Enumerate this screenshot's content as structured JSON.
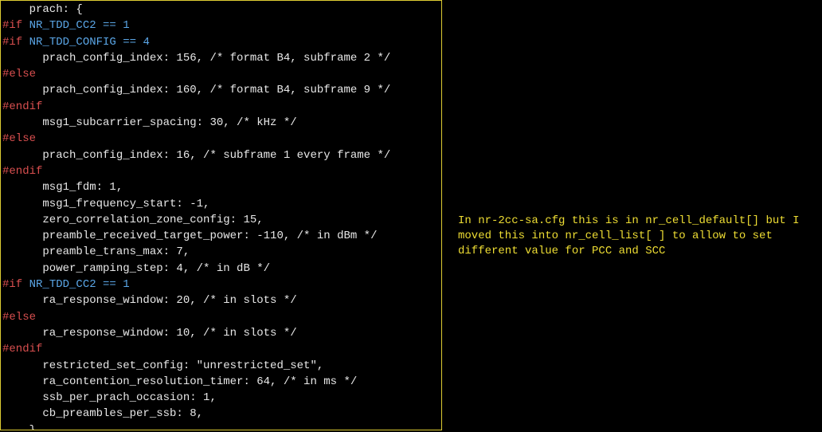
{
  "code": {
    "l0": "    prach: {",
    "l1a": "#if",
    "l1b": " NR_TDD_CC2 == 1",
    "l2a": "#if",
    "l2b": " NR_TDD_CONFIG == 4",
    "l3": "      prach_config_index: 156, /* format B4, subframe 2 */",
    "l4": "#else",
    "l5": "      prach_config_index: 160, /* format B4, subframe 9 */",
    "l6": "#endif",
    "l7": "      msg1_subcarrier_spacing: 30, /* kHz */",
    "l8": "#else",
    "l9": "      prach_config_index: 16, /* subframe 1 every frame */",
    "l10": "#endif",
    "l11": "      msg1_fdm: 1,",
    "l12": "      msg1_frequency_start: -1,",
    "l13": "      zero_correlation_zone_config: 15,",
    "l14": "      preamble_received_target_power: -110, /* in dBm */",
    "l15": "      preamble_trans_max: 7,",
    "l16": "      power_ramping_step: 4, /* in dB */",
    "l17a": "#if",
    "l17b": " NR_TDD_CC2 == 1",
    "l18": "      ra_response_window: 20, /* in slots */",
    "l19": "#else",
    "l20": "      ra_response_window: 10, /* in slots */",
    "l21": "#endif",
    "l22": "      restricted_set_config: \"unrestricted_set\",",
    "l23": "      ra_contention_resolution_timer: 64, /* in ms */",
    "l24": "      ssb_per_prach_occasion: 1,",
    "l25": "      cb_preambles_per_ssb: 8,",
    "l26": "    },"
  },
  "annotation": "In nr-2cc-sa.cfg this is in nr_cell_default[] but I moved this into nr_cell_list[ ] to allow to set different value for PCC and SCC"
}
